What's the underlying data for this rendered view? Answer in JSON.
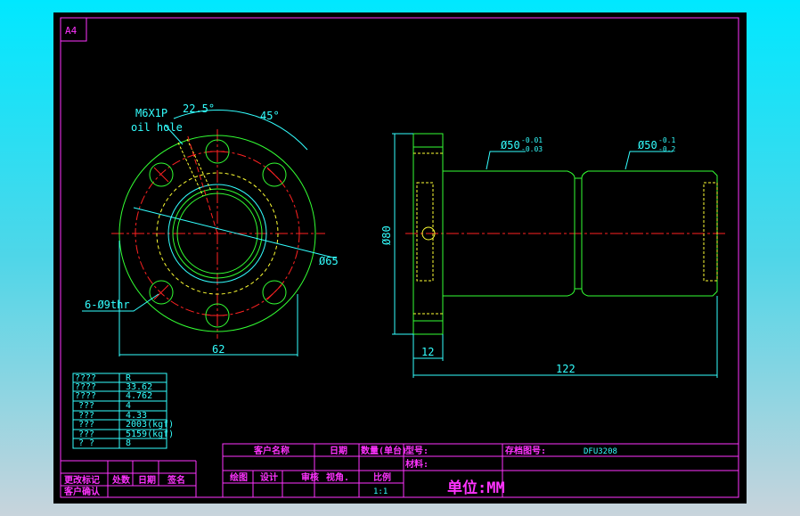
{
  "sheet_size": "A4",
  "front_view": {
    "oil_hole_label": "M6X1P",
    "oil_hole_sub": "oil hole",
    "angle_1": "22.5°",
    "angle_2": "45°",
    "diameter": "Ø65",
    "holes": "6-Ø9thr",
    "width_dim": "62"
  },
  "side_view": {
    "diameter": "Ø80",
    "shaft_1": "Ø50",
    "shaft_1_tol_upper": "-0.01",
    "shaft_1_tol_lower": "-0.03",
    "shaft_2": "Ø50",
    "shaft_2_tol_upper": "-0.1",
    "shaft_2_tol_lower": "-0.2",
    "flange_dim": "12",
    "length_dim": "122"
  },
  "spec_table": [
    {
      "k": "????",
      "v": "R"
    },
    {
      "k": "????",
      "v": "33.62"
    },
    {
      "k": "????",
      "v": "4.762"
    },
    {
      "k": "???",
      "v": "4"
    },
    {
      "k": "???",
      "v": "4.33"
    },
    {
      "k": "???",
      "v": "2003(kgf)"
    },
    {
      "k": "???",
      "v": "5159(kgf)"
    },
    {
      "k": "?  ?",
      "v": "8"
    }
  ],
  "revision_block": {
    "change_mark": "更改标记",
    "count": "处数",
    "date": "日期",
    "sign": "签名",
    "customer_confirm": "客户确认"
  },
  "title_block": {
    "customer_name": "客户名称",
    "date": "日期",
    "quantity": "数量(单台)",
    "model": "型号:",
    "archive_no": "存档图号:",
    "archive_value": "DFU3208",
    "material": "材料:",
    "drawn": "绘图",
    "design": "设计",
    "review": "审核",
    "view": "视角.",
    "scale": "比例",
    "scale_value": "1:1",
    "unit": "单位:MM"
  },
  "colors": {
    "border": "#ff33ff",
    "outline": "#33ff33",
    "center": "#ff2222",
    "hidden": "#ffff33",
    "dim": "#33ffff"
  }
}
